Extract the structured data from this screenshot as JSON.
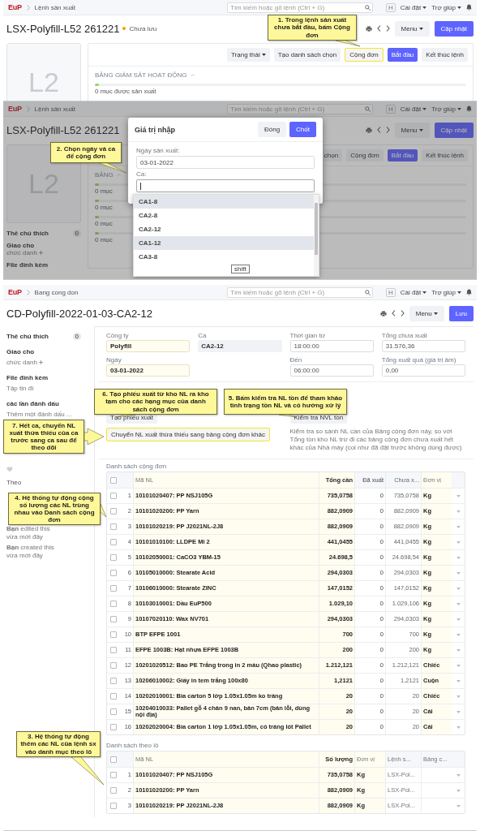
{
  "screen_1": {
    "topbar": {
      "logo": "EuP",
      "breadcrumb": "Lệnh sản xuất",
      "search_placeholder": "Tìm kiếm hoặc gõ lệnh (Ctrl + G)",
      "avatar": "H",
      "settings": "Cài đặt",
      "help": "Trợ giúp"
    },
    "title": "LSX-Polyfill-L52 261221",
    "status": "Chưa lưu",
    "menu_button": "Menu",
    "primary_button": "Cập nhật",
    "actions": [
      {
        "label": "Trạng thái",
        "kind": "dropdown"
      },
      {
        "label": "Tạo danh sách chọn",
        "kind": "plain"
      },
      {
        "label": "Cộng đơn",
        "kind": "highlighted"
      },
      {
        "label": "Bắt đầu",
        "kind": "primary"
      },
      {
        "label": "Kết thúc lệnh",
        "kind": "plain"
      }
    ],
    "image_placeholder": "L2",
    "dashboard": {
      "title": "BẢNG GIÁM SÁT HOẠT ĐỘNG",
      "progress": [
        {
          "level": 0.01,
          "caption": "0 mục được sản xuất"
        }
      ]
    },
    "callouts": [
      {
        "text": "1. Trong lệnh sản xuất chưa bắt đầu, bấm Cộng đơn"
      }
    ]
  },
  "screen_2": {
    "topbar": {
      "logo": "EuP",
      "breadcrumb": "Lệnh sản xuất",
      "search_placeholder": "Tìm kiếm hoặc gõ lệnh (Ctrl + G)",
      "avatar": "H",
      "settings": "Cài đặt",
      "help": "Trợ giúp"
    },
    "title": "LSX-Polyfill-L52 261221",
    "menu_button": "Menu",
    "primary_button": "Cập nhật",
    "actions": [
      {
        "label": "chọn",
        "kind": "plain"
      },
      {
        "label": "Cộng đơn",
        "kind": "plain"
      },
      {
        "label": "Bắt đầu",
        "kind": "primary"
      },
      {
        "label": "Kết thúc lệnh",
        "kind": "plain"
      }
    ],
    "image_placeholder": "L2",
    "sidebar": {
      "comments_label": "Thẻ chú thích",
      "comments_count": "0",
      "assign_label": "Giao cho",
      "assign_link": "chức danh",
      "attachments_label": "File đính kèm"
    },
    "dashboard": {
      "title": "BẢNG",
      "progress": [
        {
          "level": 0.01,
          "caption": "0 mục"
        },
        {
          "level": 0.01,
          "caption": "0 mục"
        },
        {
          "level": 0.01,
          "caption": "0 mục"
        },
        {
          "level": 0.01,
          "caption": "0 mục"
        }
      ]
    },
    "dialog": {
      "title": "Giá trị nhập",
      "close_button": "Đóng",
      "submit_button": "Chốt",
      "date_label": "Ngày sản xuất:",
      "date_value": "03-01-2022",
      "shift_label": "Ca:",
      "options": [
        {
          "label": "CA1-8",
          "selected": true
        },
        {
          "label": "CA2-8",
          "selected": false
        },
        {
          "label": "CA2-12",
          "selected": false
        },
        {
          "label": "CA1-12",
          "selected": true
        },
        {
          "label": "CA3-8",
          "selected": false
        }
      ],
      "tooltip": "shift"
    },
    "callouts": [
      {
        "text": "2. Chọn ngày và ca để cộng đơn"
      }
    ]
  },
  "screen_3": {
    "topbar": {
      "logo": "EuP",
      "breadcrumb": "Bang cong don",
      "search_placeholder": "Tìm kiếm hoặc gõ lệnh (Ctrl + G)",
      "avatar": "H",
      "settings": "Cài đặt",
      "help": "Trợ giúp"
    },
    "title": "CD-Polyfill-2022-01-03-CA2-12",
    "menu_button": "Menu",
    "primary_button": "Lưu",
    "sidebar": {
      "comments_label": "Thẻ chú thích",
      "comments_count": "0",
      "assign_label": "Giao cho",
      "assign_link": "chức danh",
      "attachments_label": "File đính kèm",
      "attachments_hint": "Tập tin đí",
      "tags_label": "các lần đánh dấu",
      "tags_hint": "Thêm một đánh dấu ...",
      "follow_label": "Theo",
      "activity": [
        {
          "text": "**Bạn** edited this",
          "time": "vừa mới đây"
        },
        {
          "text": "**Bạn** created this",
          "time": "vừa mới đây"
        }
      ]
    },
    "fields": [
      {
        "label": "Công ty",
        "value": "Polyfill",
        "kind": "required"
      },
      {
        "label": "Ca",
        "value": "CA2-12",
        "kind": "readonly"
      },
      {
        "label": "Thời gian từ",
        "value": "18:00:00",
        "kind": "plain"
      },
      {
        "label": "Tổng chưa xuất",
        "value": "31.576,36",
        "kind": "plain"
      },
      {
        "label": "Ngày",
        "value": "03-01-2022",
        "kind": "required"
      },
      {
        "label": "Đến",
        "value": "06:00:00",
        "kind": "plain"
      },
      {
        "label": "Tổng xuất quá (giá trị âm)",
        "value": "0,00",
        "kind": "plain"
      }
    ],
    "actions": [
      {
        "label": "Tạo phiếu xuất",
        "kind": "plain"
      },
      {
        "label": "Chuyển NL xuất thừa thiếu sang bảng cộng đơn khác",
        "kind": "highlighted"
      }
    ],
    "check_button": "Kiểm tra NVL tồn",
    "check_description": "Kiểm tra so sánh NL cần của Bảng cộng đơn này, so với Tổng tồn kho NL trừ đi các bảng cộng đơn chưa xuất hết khác của Nhà máy (coi như đã đặt trước không dùng được)",
    "tables": [
      {
        "title": "Danh sách cộng đơn",
        "all_checked": false,
        "columns": [
          {
            "label": "Mã NL",
            "kind": "input"
          },
          {
            "label": "Tổng cần",
            "kind": "input_number"
          },
          {
            "label": "Đã xuất",
            "kind": "number"
          },
          {
            "label": "Chưa x...",
            "kind": "muted_number"
          },
          {
            "label": "Đơn vị",
            "kind": "input"
          }
        ],
        "rows": [
          {
            "index": "1",
            "checked": false,
            "cells": [
              "10101020407: PP NSJ105G",
              "735,0758",
              "0",
              "735,0758",
              "Kg"
            ]
          },
          {
            "index": "2",
            "checked": false,
            "cells": [
              "10101020200: PP Yarn",
              "882,0909",
              "0",
              "882,0909",
              "Kg"
            ]
          },
          {
            "index": "3",
            "checked": false,
            "cells": [
              "10101020219: PP J2021NL-2J8",
              "882,0909",
              "0",
              "882,0909",
              "Kg"
            ]
          },
          {
            "index": "4",
            "checked": false,
            "cells": [
              "10101010100: LLDPE Mi 2",
              "441,0455",
              "0",
              "441,0455",
              "Kg"
            ]
          },
          {
            "index": "5",
            "checked": false,
            "cells": [
              "10102050001: CaCO3 YBM-15",
              "24.698,5",
              "0",
              "24.698,54",
              "Kg"
            ]
          },
          {
            "index": "6",
            "checked": false,
            "cells": [
              "10105010000: Stearate Acid",
              "294,0303",
              "0",
              "294,0303",
              "Kg"
            ]
          },
          {
            "index": "7",
            "checked": false,
            "cells": [
              "10106010000: Stearate ZINC",
              "147,0152",
              "0",
              "147,0152",
              "Kg"
            ]
          },
          {
            "index": "8",
            "checked": false,
            "cells": [
              "10103010001: Dầu EuP500",
              "1.029,10",
              "0",
              "1.029,106",
              "Kg"
            ]
          },
          {
            "index": "9",
            "checked": false,
            "cells": [
              "10107020110: Wax NV701",
              "294,0303",
              "0",
              "294,0303",
              "Kg"
            ]
          },
          {
            "index": "10",
            "checked": false,
            "cells": [
              "BTP EFPE 1001",
              "700",
              "0",
              "700",
              "Kg"
            ]
          },
          {
            "index": "11",
            "checked": false,
            "cells": [
              "EFPE 1003B: Hạt nhựa EFPE 1003B",
              "200",
              "0",
              "200",
              "Kg"
            ]
          },
          {
            "index": "12",
            "checked": false,
            "cells": [
              "10201020512: Bao PE Trắng trong in 2 màu (Qhao plastic)",
              "1.212,121",
              "0",
              "1.212,121",
              "Chiếc"
            ]
          },
          {
            "index": "13",
            "checked": false,
            "cells": [
              "10206010002: Giấy in tem trắng 100x80",
              "1,2121",
              "0",
              "1,2121",
              "Cuộn"
            ]
          },
          {
            "index": "14",
            "checked": false,
            "cells": [
              "10202010001: Bìa carton 5 lớp 1.05x1.05m ko tráng",
              "20",
              "0",
              "20",
              "Chiếc"
            ]
          },
          {
            "index": "15",
            "checked": false,
            "cells": [
              "10204010033: Pallet gỗ 4 chân 9 nan, bản 7cm (bản lỗi, dùng nội địa)",
              "20",
              "0",
              "20",
              "Cái"
            ]
          },
          {
            "index": "16",
            "checked": false,
            "cells": [
              "10202020004: Bìa carton 1 lớp 1.05x1.05m, có tráng lót Pallet",
              "20",
              "0",
              "20",
              "Cái"
            ]
          }
        ]
      },
      {
        "title": "Danh sách theo lô",
        "all_checked": false,
        "columns": [
          {
            "label": "Mã NL",
            "kind": "input"
          },
          {
            "label": "Số lượng",
            "kind": "input_number"
          },
          {
            "label": "Đơn vị",
            "kind": "input"
          },
          {
            "label": "Lệnh s...",
            "kind": "muted_text"
          },
          {
            "label": "Bảng c...",
            "kind": "muted_text"
          }
        ],
        "rows": [
          {
            "index": "1",
            "checked": false,
            "cells": [
              "10101020407: PP NSJ105G",
              "735,0758",
              "Kg",
              "LSX-Pol..."
            ]
          },
          {
            "index": "2",
            "checked": false,
            "cells": [
              "10101020200: PP Yarn",
              "882,0909",
              "Kg",
              "LSX-Pol..."
            ]
          },
          {
            "index": "3",
            "checked": false,
            "cells": [
              "10101020219: PP J2021NL-2J8",
              "882,0909",
              "Kg",
              "LSX-Pol..."
            ]
          }
        ]
      }
    ],
    "callouts": [
      {
        "text": "6. Tạo phiếu xuất từ kho NL ra kho tạm cho các hạng mục của danh sách cộng đơn"
      },
      {
        "text": "5. Bấm kiểm tra NL tồn để tham khảo tình trạng tồn NL và có hướng xử lý"
      },
      {
        "text": "7. Hết ca, chuyển NL xuất thừa thiếu của ca trước sang ca sau để theo dõi"
      },
      {
        "text": "4. Hệ thống tự động cộng số lượng các NL trùng nhau vào Danh sách cộng đơn"
      },
      {
        "text": "3. Hệ thống tự động thêm các NL của lệnh sx vào danh mục theo lô"
      }
    ]
  }
}
